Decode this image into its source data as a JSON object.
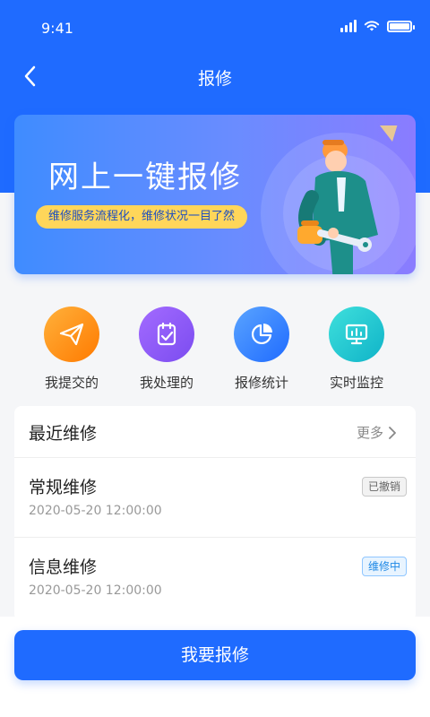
{
  "status": {
    "time": "9:41"
  },
  "nav": {
    "title": "报修",
    "back_icon": "chevron-left-icon"
  },
  "banner": {
    "title": "网上一键报修",
    "subtitle": "维修服务流程化，维修状况一目了然"
  },
  "quick_actions": [
    {
      "label": "我提交的",
      "icon": "paper-plane-icon",
      "color": "#ff8a00"
    },
    {
      "label": "我处理的",
      "icon": "clipboard-check-icon",
      "color": "#8b5cf6"
    },
    {
      "label": "报修统计",
      "icon": "pie-chart-icon",
      "color": "#2f80ff"
    },
    {
      "label": "实时监控",
      "icon": "monitor-icon",
      "color": "#18c3cf"
    }
  ],
  "recent": {
    "title": "最近维修",
    "more_label": "更多",
    "items": [
      {
        "name": "常规维修",
        "time": "2020-05-20 12:00:00",
        "status": "已撤销"
      },
      {
        "name": "信息维修",
        "time": "2020-05-20 12:00:00",
        "status": "维修中"
      }
    ]
  },
  "submit_label": "我要报修",
  "colors": {
    "primary": "#1f6bff",
    "banner_badge": "#ffd65a"
  }
}
